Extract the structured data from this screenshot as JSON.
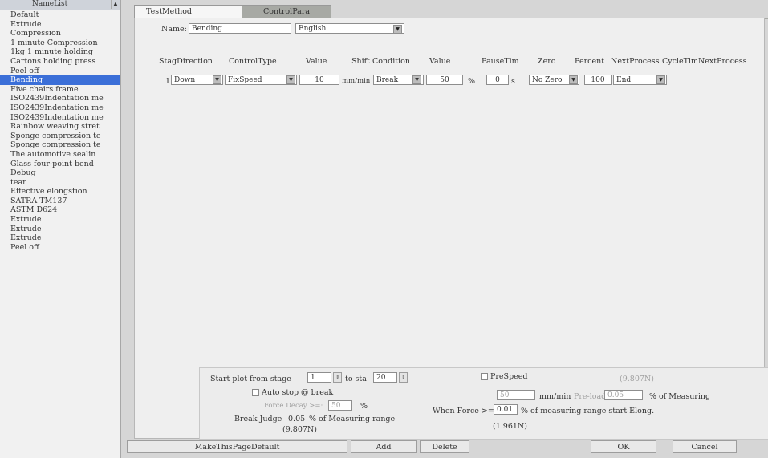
{
  "sidebar": {
    "header": "NameList",
    "items": [
      "Default",
      "Extrude",
      "Compression",
      "1 minute Compression",
      "1kg 1 minute holding",
      "Cartons holding press",
      "Peel off",
      "Bending",
      "Five chairs frame",
      "ISO2439Indentation me",
      "ISO2439Indentation me",
      "ISO2439Indentation me",
      "Rainbow weaving stret",
      "Sponge compression te",
      "Sponge compression te",
      "The automotive sealin",
      "Glass four-point bend",
      "Debug",
      "tear",
      "Effective elongstion",
      "SATRA TM137",
      "ASTM D624",
      "Extrude",
      "Extrude",
      "Extrude",
      "Peel off"
    ],
    "selected_index": 7
  },
  "tabs": {
    "test_method": "TestMethod",
    "control_para": "ControlPara"
  },
  "method": {
    "name_label": "Name:",
    "name_value": "Bending",
    "language_value": "English"
  },
  "columns": {
    "stag_direction": "StagDirection",
    "control_type": "ControlType",
    "value": "Value",
    "shift_condition": "Shift Condition",
    "value2": "Value",
    "pause_tim": "PauseTim",
    "zero": "Zero",
    "percent": "Percent",
    "next_process": "NextProcess",
    "cycle_tim": "CycleTimNextProcess"
  },
  "row": {
    "index": "1",
    "direction": "Down",
    "control_type": "FixSpeed",
    "value": "10",
    "unit": "mm/min",
    "shift_condition": "Break",
    "shift_value": "50",
    "shift_unit": "%",
    "pause": "0",
    "pause_unit": "s",
    "zero": "No Zero",
    "percent": "100",
    "next_process": "End"
  },
  "plot": {
    "start_label": "Start plot from stage",
    "start_value": "1",
    "to_label": "to sta",
    "to_value": "20",
    "auto_stop_label": "Auto stop @ break",
    "force_decay_label": "Force Decay >=:",
    "force_decay_value": "50",
    "force_decay_unit": "%",
    "break_judge_label": "Break Judge",
    "break_judge_value": "0.05",
    "break_judge_unit": "% of Measuring range",
    "break_judge_force": "(9.807N)"
  },
  "prespeed": {
    "label": "PreSpeed",
    "force_note": "(9.807N)",
    "speed_value": "50",
    "speed_unit": "mm/min",
    "preload_label": "Pre-load",
    "preload_value": "0.05",
    "preload_unit": "% of Measuring",
    "when_force_label": "When Force >=",
    "when_force_value": "0.01",
    "when_force_unit": "% of measuring range start Elong.",
    "when_force_note": "(1.961N)"
  },
  "buttons": {
    "make_default": "MakeThisPageDefault",
    "add": "Add",
    "delete": "Delete",
    "ok": "OK",
    "cancel": "Cancel"
  }
}
